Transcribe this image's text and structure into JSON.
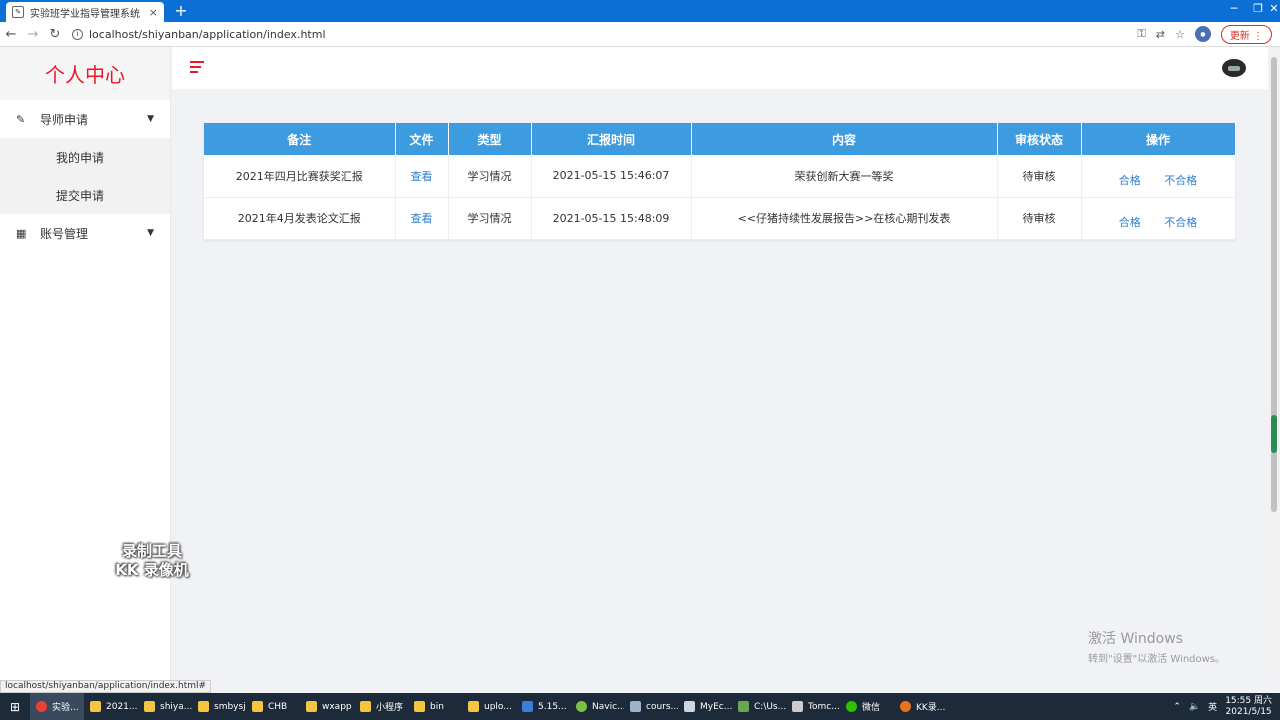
{
  "browser": {
    "tab_title": "实验班学业指导管理系统",
    "tab_close": "×",
    "new_tab": "+",
    "window_controls": [
      "─",
      "❐",
      "✕"
    ],
    "url": "localhost/shiyanban/application/index.html",
    "update_label": "更新",
    "status_url": "localhost/shiyanban/application/index.html#"
  },
  "sidebar": {
    "brand": "个人中心",
    "menus": [
      {
        "label": "导师申请",
        "icon": "pencil-icon",
        "sub": [
          "我的申请",
          "提交申请"
        ]
      },
      {
        "label": "账号管理",
        "icon": "grid-icon",
        "sub": []
      }
    ]
  },
  "watermark": {
    "line1": "录制工具",
    "line2": "KK 录像机"
  },
  "table": {
    "headers": [
      "备注",
      "文件",
      "类型",
      "汇报时间",
      "内容",
      "审核状态",
      "操作"
    ],
    "rows": [
      {
        "note": "2021年四月比赛获奖汇报",
        "file": "查看",
        "type": "学习情况",
        "time": "2021-05-15 15:46:07",
        "content": "荣获创新大赛一等奖",
        "status": "待审核",
        "pass": "合格",
        "fail": "不合格"
      },
      {
        "note": "2021年4月发表论文汇报",
        "file": "查看",
        "type": "学习情况",
        "time": "2021-05-15 15:48:09",
        "content": "<<仔猪持续性发展报告>>在核心期刊发表",
        "status": "待审核",
        "pass": "合格",
        "fail": "不合格"
      }
    ]
  },
  "activation": {
    "line1": "激活 Windows",
    "line2": "转到\"设置\"以激活 Windows。"
  },
  "taskbar": {
    "items": [
      "实验...",
      "2021...",
      "shiya...",
      "smbysj",
      "CHB",
      "wxapp",
      "小程序",
      "bin",
      "uplo...",
      "5.15...",
      "Navic...",
      "cours...",
      "MyEc...",
      "C:\\Us...",
      "Tomc...",
      "微信",
      "KK录..."
    ],
    "ime": "英",
    "time": "15:55 周六",
    "date": "2021/5/15"
  },
  "colors": {
    "brand": "#e8192c",
    "header": "#3d9be0",
    "link": "#2f7fd0",
    "chrome": "#0b6fd6"
  }
}
